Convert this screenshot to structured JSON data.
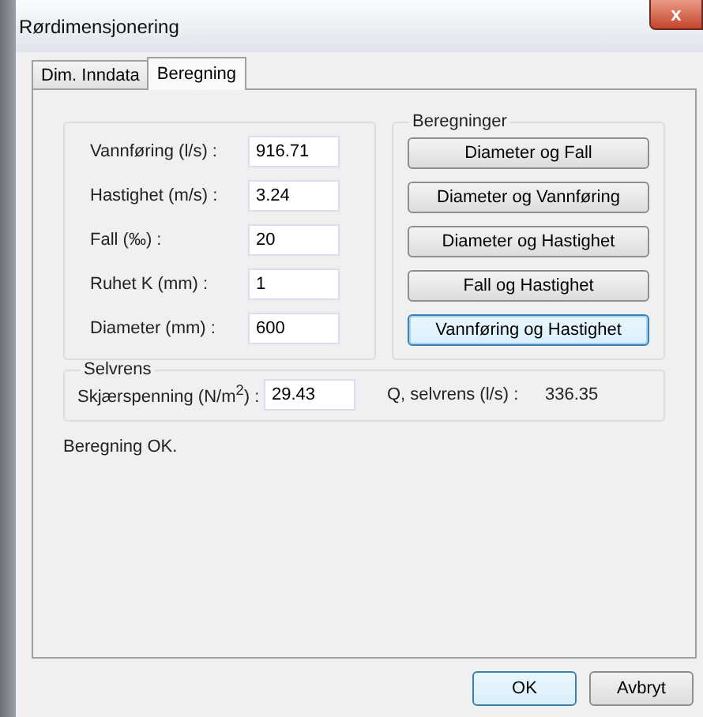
{
  "window": {
    "title": "Rørdimensjonering",
    "close": "x"
  },
  "tabs": [
    {
      "label": "Dim. Inndata",
      "selected": false
    },
    {
      "label": "Beregning",
      "selected": true
    }
  ],
  "inputs": [
    {
      "label": "Vannføring (l/s) :",
      "value": "916.71"
    },
    {
      "label": "Hastighet (m/s) :",
      "value": "3.24"
    },
    {
      "label": "Fall  (‰) :",
      "value": "20"
    },
    {
      "label": "Ruhet  K (mm) :",
      "value": "1"
    },
    {
      "label": "Diameter (mm) :",
      "value": "600"
    }
  ],
  "calculations": {
    "title": "Beregninger",
    "buttons": [
      {
        "label": "Diameter og Fall",
        "focused": false
      },
      {
        "label": "Diameter og Vannføring",
        "focused": false
      },
      {
        "label": "Diameter og Hastighet",
        "focused": false
      },
      {
        "label": "Fall og Hastighet",
        "focused": false
      },
      {
        "label": "Vannføring og Hastighet",
        "focused": true
      }
    ]
  },
  "self_cleaning": {
    "title": "Selvrens",
    "shear_label": "Skjærspenning (N/m$^{2}$) :",
    "shear_value": "29.43",
    "q_label": "Q, selvrens (l/s) :",
    "q_value": "336.35"
  },
  "status": "Beregning OK.",
  "dialog_buttons": [
    {
      "label": "OK",
      "default": true
    },
    {
      "label": "Avbryt",
      "default": false
    }
  ]
}
